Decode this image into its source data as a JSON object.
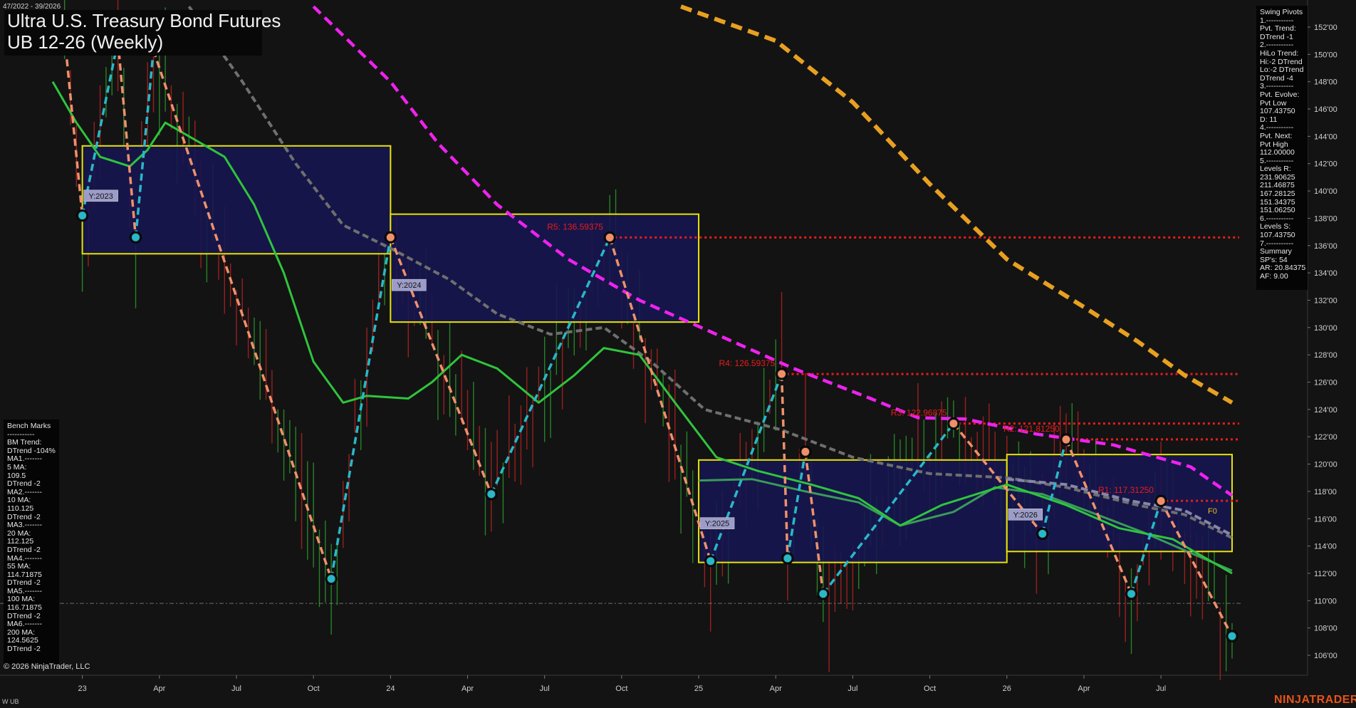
{
  "header": {
    "date_range": "47/2022 - 39/2026",
    "title_line1": "Ultra U.S. Treasury Bond Futures",
    "title_line2": "UB 12-26 (Weekly)"
  },
  "swing_pivots": {
    "lines": [
      "Swing Pivots",
      "1.-----------",
      "Pvt. Trend:",
      "DTrend -1",
      "2.-----------",
      "HiLo Trend:",
      "Hi:-2 DTrend",
      "Lo:-2 DTrend",
      "DTrend -4",
      "3.-----------",
      "Pvt. Evolve:",
      "Pvt Low",
      "107.43750",
      "D: 11",
      "4.-----------",
      "Pvt. Next:",
      "Pvt High",
      "112.00000",
      "5.-----------",
      "Levels R:",
      "231.90625",
      "211.46875",
      "167.28125",
      "151.34375",
      "151.06250",
      "6.-----------",
      "Levels S:",
      "107.43750",
      "7.-----------",
      "Summary",
      "SP's: 54",
      "AR: 20.84375",
      "AF: 9.00"
    ]
  },
  "bench_marks": {
    "lines": [
      "Bench Marks",
      "-----------",
      "BM Trend:",
      "DTrend -104%",
      "MA1.-------",
      "5 MA:",
      "109.5",
      "DTrend -2",
      "MA2.-------",
      "10 MA:",
      "110.125",
      "DTrend -2",
      "MA3.-------",
      "20 MA:",
      "112.125",
      "DTrend -2",
      "MA4.-------",
      "55 MA:",
      "114.71875",
      "DTrend -2",
      "MA5.-------",
      "100 MA:",
      "116.71875",
      "DTrend -2",
      "MA6.-------",
      "200 MA:",
      "124.5625",
      "DTrend -2"
    ]
  },
  "footer": {
    "copyright": "© 2026 NinjaTrader, LLC",
    "symbol": "W UB",
    "brand": "NINJATRADER"
  },
  "colors": {
    "background": "#131313",
    "up_bar": "#2ea82e",
    "down_bar": "#c82424",
    "ma_fast": "#2fc43c",
    "ma_mid": "#3a9a5a",
    "ma_grey": "#6f6f6f",
    "ma_grey2": "#8686a8",
    "ma_magenta": "#ee22ee",
    "ma_orange": "#e8a020",
    "swing_up": "#29b8c8",
    "swing_down": "#f0906a",
    "resistance": "#e81c1c",
    "year_box_fill": "#161650",
    "year_box_border": "#e8e400"
  },
  "chart_data": {
    "type": "line",
    "title": "Ultra U.S. Treasury Bond Futures UB 12-26 (Weekly)",
    "xlabel": "",
    "ylabel": "",
    "ylim": [
      105.5,
      153
    ],
    "x_tick_labels": [
      "23",
      "Apr",
      "Jul",
      "Oct",
      "24",
      "Apr",
      "Jul",
      "Oct",
      "25",
      "Apr",
      "Jul",
      "Oct",
      "26",
      "Apr",
      "Jul"
    ],
    "y_tick_values": [
      106,
      108,
      110,
      112,
      114,
      116,
      118,
      120,
      122,
      124,
      126,
      128,
      130,
      132,
      134,
      136,
      138,
      140,
      142,
      144,
      146,
      148,
      150,
      152
    ],
    "y_tick_labels": [
      "106'00",
      "108'00",
      "110'00",
      "112'00",
      "114'00",
      "116'00",
      "118'00",
      "120'00",
      "122'00",
      "124'00",
      "126'00",
      "128'00",
      "130'00",
      "132'00",
      "134'00",
      "136'00",
      "138'00",
      "140'00",
      "142'00",
      "144'00",
      "146'00",
      "148'00",
      "150'00",
      "152'00"
    ],
    "x_range": [
      "2022-11-20",
      "2026-09-27"
    ],
    "grid": false,
    "swing_pivots": [
      {
        "date": "2022-12-11",
        "price": 151.3,
        "kind": "high"
      },
      {
        "date": "2023-01-01",
        "price": 138.2,
        "kind": "low"
      },
      {
        "date": "2023-02-12",
        "price": 151.0,
        "kind": "high"
      },
      {
        "date": "2023-03-05",
        "price": 136.6,
        "kind": "low"
      },
      {
        "date": "2023-03-26",
        "price": 150.3,
        "kind": "high"
      },
      {
        "date": "2023-10-22",
        "price": 111.6,
        "kind": "low"
      },
      {
        "date": "2023-12-31",
        "price": 136.6,
        "kind": "high"
      },
      {
        "date": "2024-04-28",
        "price": 117.8,
        "kind": "low"
      },
      {
        "date": "2024-09-15",
        "price": 136.59,
        "kind": "high"
      },
      {
        "date": "2025-01-12",
        "price": 112.9,
        "kind": "low"
      },
      {
        "date": "2025-04-06",
        "price": 126.6,
        "kind": "high"
      },
      {
        "date": "2025-04-13",
        "price": 113.1,
        "kind": "low"
      },
      {
        "date": "2025-05-04",
        "price": 120.9,
        "kind": "high"
      },
      {
        "date": "2025-05-25",
        "price": 110.5,
        "kind": "low"
      },
      {
        "date": "2025-10-26",
        "price": 122.97,
        "kind": "high"
      },
      {
        "date": "2026-02-08",
        "price": 114.9,
        "kind": "low"
      },
      {
        "date": "2026-03-08",
        "price": 121.8,
        "kind": "high"
      },
      {
        "date": "2026-05-24",
        "price": 110.5,
        "kind": "low"
      },
      {
        "date": "2026-06-28",
        "price": 117.3,
        "kind": "high"
      },
      {
        "date": "2026-09-20",
        "price": 107.4,
        "kind": "low"
      }
    ],
    "year_boxes": [
      {
        "label": "Y:2023",
        "start": "2023-01-01",
        "end": "2023-12-31",
        "high": 143.3,
        "low": 135.4
      },
      {
        "label": "Y:2024",
        "start": "2023-12-31",
        "end": "2024-12-29",
        "high": 138.3,
        "low": 130.4
      },
      {
        "label": "Y:2025",
        "start": "2024-12-29",
        "end": "2025-12-28",
        "high": 120.3,
        "low": 112.8
      },
      {
        "label": "Y:2026",
        "start": "2025-12-28",
        "end": "2026-09-20",
        "high": 120.7,
        "low": 113.6
      }
    ],
    "resistance_levels": [
      {
        "label": "R5: 136.59375",
        "price": 136.59375,
        "from": "2024-09-15"
      },
      {
        "label": "R4: 126.59375",
        "price": 126.59375,
        "from": "2025-04-06"
      },
      {
        "label": "R3: 122.96875",
        "price": 122.96875,
        "from": "2025-10-26"
      },
      {
        "label": "R2: 121.81250",
        "price": 121.8125,
        "from": "2026-03-08"
      },
      {
        "label": "R1: 117.31250",
        "price": 117.3125,
        "from": "2026-06-28"
      }
    ],
    "pivot_f0_label": "F0",
    "baseline_price": 109.8,
    "series": [
      {
        "id": "ma_magenta",
        "style": "dashed",
        "points": [
          [
            "2023-10-01",
            153.5
          ],
          [
            "2023-12-31",
            148.0
          ],
          [
            "2024-02-25",
            143.5
          ],
          [
            "2024-05-05",
            139.0
          ],
          [
            "2024-07-28",
            135.0
          ],
          [
            "2024-10-20",
            132.0
          ],
          [
            "2025-01-19",
            129.5
          ],
          [
            "2025-04-20",
            127.0
          ],
          [
            "2025-07-20",
            124.8
          ],
          [
            "2025-09-14",
            123.4
          ],
          [
            "2025-11-09",
            123.3
          ],
          [
            "2026-02-01",
            122.2
          ],
          [
            "2026-05-03",
            121.4
          ],
          [
            "2026-08-02",
            119.8
          ],
          [
            "2026-09-20",
            117.7
          ]
        ]
      },
      {
        "id": "ma_orange",
        "style": "dashed",
        "points": [
          [
            "2024-12-08",
            153.5
          ],
          [
            "2025-03-30",
            151.0
          ],
          [
            "2025-06-29",
            146.5
          ],
          [
            "2025-09-28",
            140.5
          ],
          [
            "2025-12-28",
            135.0
          ],
          [
            "2026-03-29",
            131.5
          ],
          [
            "2026-05-31",
            129.0
          ],
          [
            "2026-07-26",
            126.5
          ],
          [
            "2026-09-20",
            124.5
          ]
        ]
      },
      {
        "id": "ma_grey",
        "style": "solid",
        "points": [
          [
            "2023-05-07",
            153.5
          ],
          [
            "2023-07-09",
            148.0
          ],
          [
            "2023-09-10",
            142.0
          ],
          [
            "2023-11-05",
            137.5
          ],
          [
            "2023-12-31",
            135.8
          ],
          [
            "2024-03-10",
            133.5
          ],
          [
            "2024-05-05",
            131.0
          ],
          [
            "2024-07-07",
            129.5
          ],
          [
            "2024-09-08",
            130.0
          ],
          [
            "2024-11-03",
            127.5
          ],
          [
            "2025-01-05",
            124.0
          ],
          [
            "2025-04-06",
            122.5
          ],
          [
            "2025-06-29",
            120.5
          ],
          [
            "2025-09-28",
            119.3
          ],
          [
            "2025-12-28",
            119.0
          ],
          [
            "2026-03-08",
            118.3
          ],
          [
            "2026-05-31",
            117.0
          ],
          [
            "2026-07-26",
            116.3
          ],
          [
            "2026-09-20",
            114.6
          ]
        ]
      },
      {
        "id": "ma_mid",
        "style": "solid",
        "points": [
          [
            "2024-12-29",
            118.8
          ],
          [
            "2025-03-02",
            118.9
          ],
          [
            "2025-05-04",
            118.0
          ],
          [
            "2025-07-06",
            117.2
          ],
          [
            "2025-08-24",
            115.5
          ],
          [
            "2025-10-26",
            116.5
          ],
          [
            "2025-12-14",
            118.3
          ],
          [
            "2026-02-08",
            117.8
          ],
          [
            "2026-04-05",
            116.5
          ],
          [
            "2026-06-07",
            115.0
          ],
          [
            "2026-08-02",
            113.5
          ],
          [
            "2026-09-20",
            112.2
          ]
        ]
      },
      {
        "id": "ma_fast",
        "style": "solid",
        "points": [
          [
            "2022-11-27",
            148.0
          ],
          [
            "2022-12-25",
            145.0
          ],
          [
            "2023-01-22",
            142.5
          ],
          [
            "2023-02-26",
            141.8
          ],
          [
            "2023-03-19",
            143.0
          ],
          [
            "2023-04-09",
            145.0
          ],
          [
            "2023-05-07",
            144.0
          ],
          [
            "2023-06-18",
            142.5
          ],
          [
            "2023-07-23",
            139.0
          ],
          [
            "2023-08-27",
            134.0
          ],
          [
            "2023-10-01",
            127.5
          ],
          [
            "2023-11-05",
            124.5
          ],
          [
            "2023-12-03",
            125.0
          ],
          [
            "2024-01-21",
            124.8
          ],
          [
            "2024-02-18",
            126.0
          ],
          [
            "2024-03-24",
            128.0
          ],
          [
            "2024-05-05",
            127.0
          ],
          [
            "2024-06-23",
            124.5
          ],
          [
            "2024-08-04",
            126.5
          ],
          [
            "2024-09-08",
            128.5
          ],
          [
            "2024-10-20",
            128.0
          ],
          [
            "2024-12-01",
            124.5
          ],
          [
            "2025-01-19",
            120.5
          ],
          [
            "2025-03-09",
            119.5
          ],
          [
            "2025-05-11",
            118.5
          ],
          [
            "2025-07-06",
            117.5
          ],
          [
            "2025-08-24",
            115.5
          ],
          [
            "2025-10-12",
            117.0
          ],
          [
            "2025-12-28",
            118.5
          ],
          [
            "2026-03-08",
            117.0
          ],
          [
            "2026-05-10",
            115.3
          ],
          [
            "2026-07-12",
            114.5
          ],
          [
            "2026-09-20",
            112.0
          ]
        ]
      },
      {
        "id": "ma_grey2",
        "style": "dashed",
        "points": [
          [
            "2025-12-28",
            118.9
          ],
          [
            "2026-03-08",
            118.5
          ],
          [
            "2026-05-24",
            117.3
          ],
          [
            "2026-07-26",
            116.6
          ],
          [
            "2026-09-20",
            114.8
          ]
        ]
      }
    ]
  }
}
